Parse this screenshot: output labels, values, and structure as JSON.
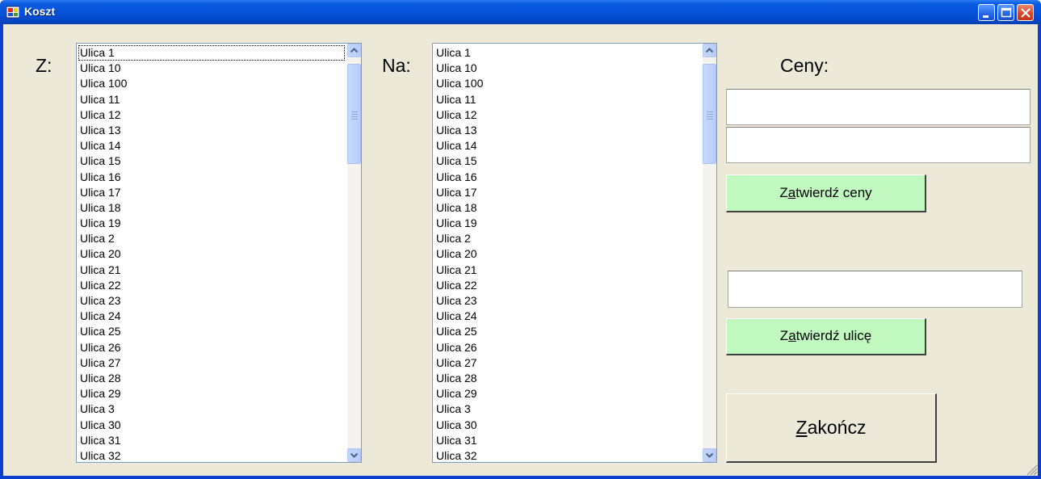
{
  "window": {
    "title": "Koszt",
    "minimize_icon": "minimize-icon",
    "maximize_icon": "maximize-icon",
    "close_icon": "close-icon"
  },
  "from": {
    "label": "Z:",
    "items": [
      "Ulica 1",
      "Ulica 10",
      "Ulica 100",
      "Ulica 11",
      "Ulica 12",
      "Ulica 13",
      "Ulica 14",
      "Ulica 15",
      "Ulica 16",
      "Ulica 17",
      "Ulica 18",
      "Ulica 19",
      "Ulica 2",
      "Ulica 20",
      "Ulica 21",
      "Ulica 22",
      "Ulica 23",
      "Ulica 24",
      "Ulica 25",
      "Ulica 26",
      "Ulica 27",
      "Ulica 28",
      "Ulica 29",
      "Ulica 3",
      "Ulica 30",
      "Ulica 31",
      "Ulica 32"
    ]
  },
  "to": {
    "label": "Na:",
    "items": [
      "Ulica 1",
      "Ulica 10",
      "Ulica 100",
      "Ulica 11",
      "Ulica 12",
      "Ulica 13",
      "Ulica 14",
      "Ulica 15",
      "Ulica 16",
      "Ulica 17",
      "Ulica 18",
      "Ulica 19",
      "Ulica 2",
      "Ulica 20",
      "Ulica 21",
      "Ulica 22",
      "Ulica 23",
      "Ulica 24",
      "Ulica 25",
      "Ulica 26",
      "Ulica 27",
      "Ulica 28",
      "Ulica 29",
      "Ulica 3",
      "Ulica 30",
      "Ulica 31",
      "Ulica 32"
    ]
  },
  "prices": {
    "label": "Ceny:",
    "field1_value": "",
    "field2_value": "",
    "confirm_prices": {
      "mnemonic": "a",
      "before": "Z",
      "after": "twierdź ceny"
    },
    "street_value": "",
    "confirm_street": {
      "mnemonic": "a",
      "before": "Z",
      "after": "twierdź ulicę"
    },
    "finish": {
      "mnemonic": "Z",
      "before": "",
      "after": "akończ"
    }
  },
  "colors": {
    "title_bar": "#0551d8",
    "window_bg": "#ece9d8",
    "green_button": "#c0f8c0"
  }
}
